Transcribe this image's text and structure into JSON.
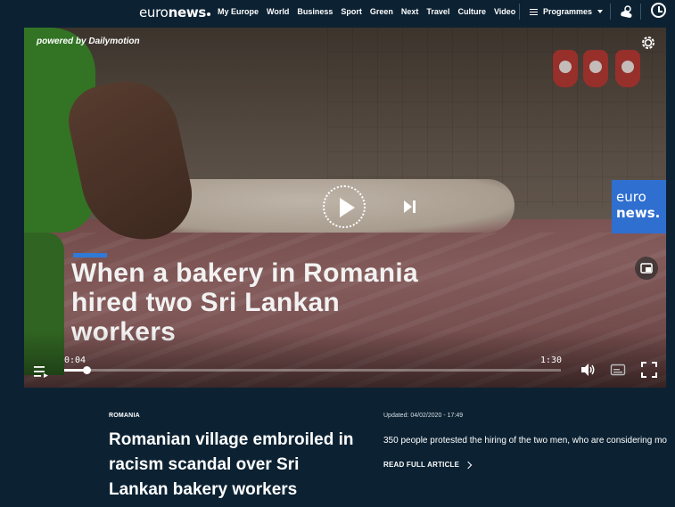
{
  "header": {
    "logo_prefix": "euro",
    "logo_suffix": "news",
    "nav": [
      "My Europe",
      "World",
      "Business",
      "Sport",
      "Green",
      "Next",
      "Travel",
      "Culture",
      "Video"
    ],
    "programmes_label": "Programmes",
    "icons": [
      "list-icon",
      "chevron-down-icon",
      "weather-icon",
      "clock-icon"
    ]
  },
  "player": {
    "powered_by": "powered by Dailymotion",
    "overlay_title": "When a bakery in Romania hired two Sri Lankan workers",
    "logo_line1": "euro",
    "logo_line2": "news.",
    "current_time": "0:04",
    "duration": "1:30",
    "progress_fraction": 0.044,
    "accent_color": "#2f7ad8",
    "icons": [
      "settings-gear-icon",
      "play-icon",
      "skip-next-icon",
      "picture-in-picture-icon",
      "playlist-icon",
      "volume-icon",
      "subtitles-icon",
      "fullscreen-icon"
    ]
  },
  "article": {
    "kicker": "ROMANIA",
    "headline": "Romanian village embroiled in racism scandal over Sri Lankan bakery workers",
    "updated": "Updated: 04/02/2020 - 17:49",
    "summary": "350 people protested the hiring of the two men, who are considering mo",
    "read_more": "READ FULL ARTICLE"
  },
  "colors": {
    "page_background": "#0c2233",
    "text": "#ffffff"
  }
}
